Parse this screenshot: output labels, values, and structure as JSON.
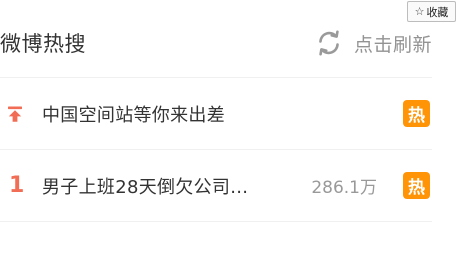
{
  "favorite_button": {
    "icon": "star-outline-icon",
    "label": "收藏"
  },
  "header": {
    "title": "微博热搜",
    "refresh_icon": "refresh-icon",
    "refresh_label": "点击刷新"
  },
  "hot_list": [
    {
      "rank": "",
      "rank_icon": "pin-up-icon",
      "title": "中国空间站等你来出差",
      "count": "",
      "badge": "热"
    },
    {
      "rank": "1",
      "rank_icon": "",
      "title": "男子上班28天倒欠公司...",
      "count": "286.1万",
      "badge": "热"
    }
  ],
  "colors": {
    "accent": "#f26d55",
    "badge": "#ff9406",
    "muted": "#939393"
  }
}
